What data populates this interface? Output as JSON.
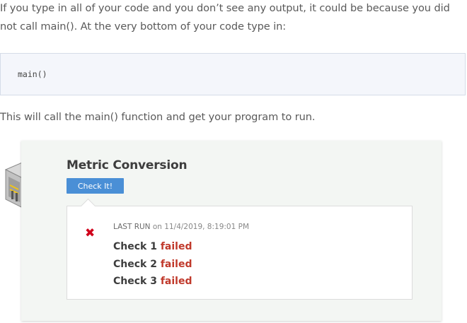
{
  "paragraph1": "If you type in all of your code and you don’t see any output, it could be because you did not call main(). At the very bottom of your code type in:",
  "code": "main()",
  "paragraph2": "This will call the main() function and get your program to run.",
  "widget": {
    "title": "Metric Conversion",
    "check_button": "Check It!",
    "last_run_label": "LAST RUN",
    "last_run_on": "on 11/4/2019, 8:19:01 PM",
    "status_icon": "x-mark-icon",
    "status_color": "#d0021b",
    "checks": [
      {
        "label": "Check 1",
        "status": "failed"
      },
      {
        "label": "Check 2",
        "status": "failed"
      },
      {
        "label": "Check 3",
        "status": "failed"
      }
    ]
  },
  "colors": {
    "button": "#4a8fd6",
    "failed": "#c0392b",
    "card_bg": "#f3f6f3"
  }
}
